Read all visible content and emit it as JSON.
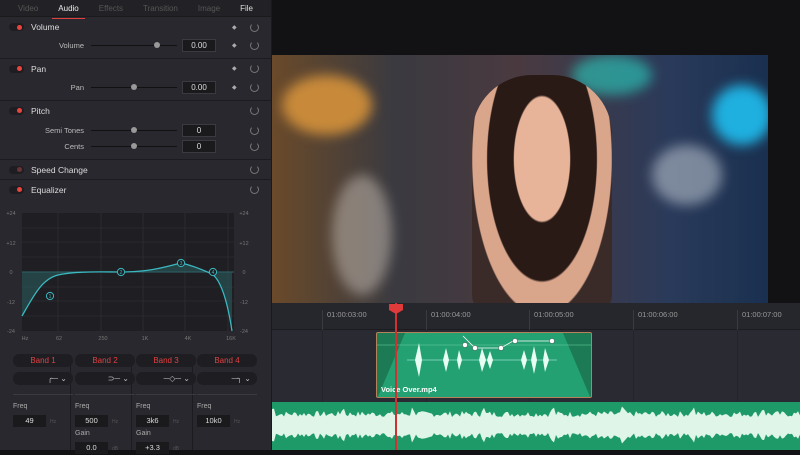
{
  "tabs": [
    "Video",
    "Audio",
    "Effects",
    "Transition",
    "Image",
    "File"
  ],
  "volume": {
    "title": "Volume",
    "param": "Volume",
    "value": "0.00",
    "knob": 0.75
  },
  "pan": {
    "title": "Pan",
    "param": "Pan",
    "value": "0.00",
    "knob": 0.5
  },
  "pitch": {
    "title": "Pitch",
    "semitones_label": "Semi Tones",
    "semitones": "0",
    "cents_label": "Cents",
    "cents": "0"
  },
  "speed": {
    "title": "Speed Change"
  },
  "equalizer": {
    "title": "Equalizer",
    "y_ticks": [
      "+24",
      "+12",
      "0",
      "-12",
      "-24"
    ],
    "x_ticks": [
      "Hz",
      "62",
      "250",
      "1K",
      "4K",
      "16K"
    ],
    "bands": [
      {
        "label": "Band 1",
        "shape": "low-cut",
        "freq_label": "Freq",
        "freq": "49",
        "unit": "Hz"
      },
      {
        "label": "Band 2",
        "shape": "low-shelf",
        "freq_label": "Freq",
        "freq": "500",
        "unit": "Hz",
        "gain_label": "Gain",
        "gain": "0.0",
        "gain_unit": "dB"
      },
      {
        "label": "Band 3",
        "shape": "bell",
        "freq_label": "Freq",
        "freq": "3k6",
        "unit": "Hz",
        "gain_label": "Gain",
        "gain": "+3.3",
        "gain_unit": "dB"
      },
      {
        "label": "Band 4",
        "shape": "high-cut",
        "freq_label": "Freq",
        "freq": "10k0",
        "unit": "Hz"
      }
    ],
    "nodes": [
      "1",
      "2",
      "3",
      "4"
    ]
  },
  "timeline": {
    "timecodes": [
      "01:00:03:00",
      "01:00:04:00",
      "01:00:05:00",
      "01:00:06:00",
      "01:00:07:00"
    ],
    "clip_name": "Voice Over.mp4"
  },
  "colors": {
    "accent": "#e04040",
    "eq": "#3bb8c0",
    "clip": "#1c7a54",
    "music": "#1d9a68"
  }
}
